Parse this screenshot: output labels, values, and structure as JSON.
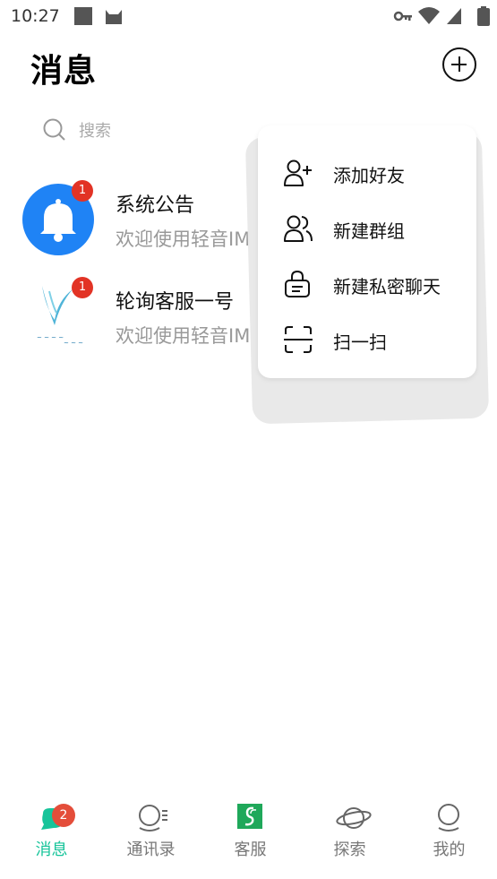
{
  "status": {
    "time": "10:27"
  },
  "header": {
    "title": "消息"
  },
  "search": {
    "placeholder": "搜索"
  },
  "conversations": [
    {
      "name": "系统公告",
      "preview": "欢迎使用轻音IM",
      "badge": "1",
      "avatar": "bell-icon"
    },
    {
      "name": "轮询客服一号",
      "preview": "欢迎使用轻音IM",
      "badge": "1",
      "avatar": "brand-logo"
    }
  ],
  "menu": {
    "items": [
      {
        "label": "添加好友",
        "icon": "add-friend-icon"
      },
      {
        "label": "新建群组",
        "icon": "group-icon"
      },
      {
        "label": "新建私密聊天",
        "icon": "lock-icon"
      },
      {
        "label": "扫一扫",
        "icon": "scan-icon"
      }
    ]
  },
  "tabs": [
    {
      "label": "消息",
      "active": true,
      "badge": "2"
    },
    {
      "label": "通讯录"
    },
    {
      "label": "客服"
    },
    {
      "label": "探索"
    },
    {
      "label": "我的"
    }
  ],
  "colors": {
    "accent": "#17c49a",
    "badge": "#e23325",
    "bell_bg": "#1f83f5"
  }
}
